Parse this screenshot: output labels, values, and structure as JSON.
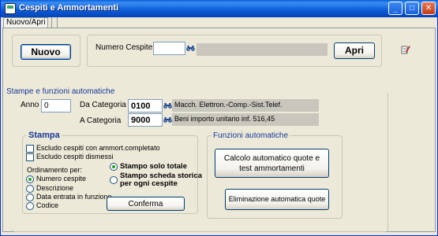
{
  "window": {
    "title": "Cespiti e Ammortamenti",
    "minimize_glyph": "_",
    "maximize_glyph": "□",
    "close_glyph": "✕"
  },
  "tabs": [
    {
      "label": "Nuovo/Apri",
      "selected": true
    },
    {
      "label": "",
      "selected": false
    }
  ],
  "top": {
    "nuovo_label": "Nuovo",
    "numero_cespite_label": "Numero Cespite",
    "numero_cespite_value": "",
    "numero_cespite_description": "",
    "apri_label": "Apri"
  },
  "stampe": {
    "title": "Stampe e funzioni automatiche",
    "anno_label": "Anno",
    "anno_value": "0",
    "da_categoria_label": "Da Categoria",
    "da_categoria_value": "0100",
    "da_categoria_description": "Macch. Elettron.-Comp.-Sist.Telef.",
    "a_categoria_label": "A Categoria",
    "a_categoria_value": "9000",
    "a_categoria_description": "Beni importo unitario inf. 516,45"
  },
  "stampa": {
    "title": "Stampa",
    "escludo_completato": "Escludo cespiti con ammort.completato",
    "escludo_dismessi": "Escludo cespiti dismessi",
    "ordinamento_label": "Ordinamento per:",
    "ordinamento_options": [
      {
        "label": "Numero cespite",
        "checked": true
      },
      {
        "label": "Descrizione",
        "checked": false
      },
      {
        "label": "Data entrata in funzione",
        "checked": false
      },
      {
        "label": "Codice",
        "checked": false
      }
    ],
    "stampo_solo_totale": "Stampo solo totale",
    "stampo_scheda_line1": "Stampo scheda storica",
    "stampo_scheda_line2": "per ogni cespite",
    "conferma_label": "Conferma"
  },
  "funzioni": {
    "title": "Funzioni automatiche",
    "calcolo_line1": "Calcolo automatico quote  e",
    "calcolo_line2": "test ammortamenti",
    "eliminazione_label": "Eliminazione automatica quote"
  },
  "icons": {
    "lookup": "binoculars-icon",
    "side": "edit-document-icon"
  },
  "colors": {
    "titlebar": "#0A5FDB",
    "section_title": "#16389A",
    "readonly_bg": "#C9C6BE"
  }
}
